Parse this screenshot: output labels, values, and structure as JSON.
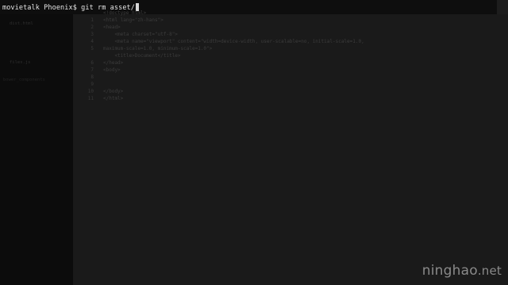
{
  "terminal": {
    "prompt": "movietalk Phoenix$",
    "command": "git rm asset/"
  },
  "sidebar": {
    "items": [
      "dist.html",
      "files.js",
      "bower_components"
    ]
  },
  "editor": {
    "line_numbers": [
      "1",
      "2",
      "3",
      "4",
      "5",
      "6",
      "7",
      "8",
      "9",
      "10",
      "11"
    ],
    "lines": [
      "<!doctype html>",
      "<html lang=\"zh-hans\">",
      "<head>",
      "    <meta charset=\"utf-8\">",
      "    <meta name=\"viewport\" content=\"width=device-width, user-scalable=no, initial-scale=1.0,",
      "maximum-scale=1.0, minimum-scale=1.0\">",
      "    <title>Document</title>",
      "</head>",
      "<body>",
      "",
      "</body>",
      "</html>"
    ]
  },
  "watermark": {
    "brand": "ninghao",
    "suffix": ".net"
  }
}
